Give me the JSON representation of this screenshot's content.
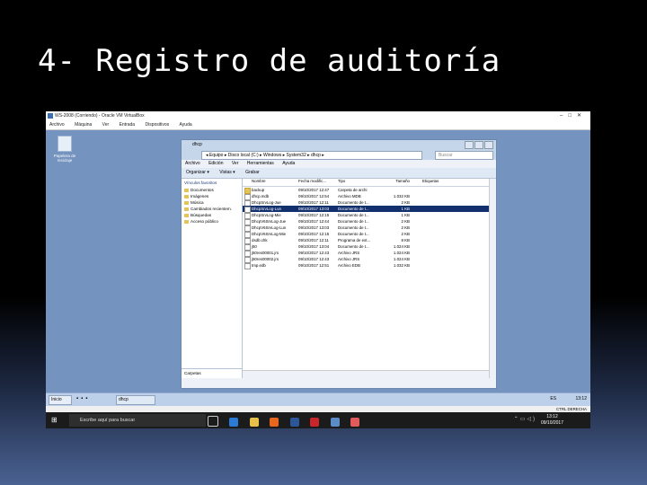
{
  "slide": {
    "title": "4- Registro de auditoría"
  },
  "vbox": {
    "title": "WS-2008 (Corriendo) - Oracle VM VirtualBox",
    "menu": [
      "Archivo",
      "Máquina",
      "Ver",
      "Entrada",
      "Dispositivos",
      "Ayuda"
    ],
    "status_right": "CTRL DERECHA"
  },
  "desktop": {
    "recycle_label": "Papelera de reciclaje"
  },
  "explorer": {
    "title": "dhcp",
    "address": "◂ Equipo ▸ Disco local (C:) ▸ Windows ▸ System32 ▸ dhcp ▸",
    "search_placeholder": "Buscar",
    "menu": [
      "Archivo",
      "Edición",
      "Ver",
      "Herramientas",
      "Ayuda"
    ],
    "toolbar": [
      "Organizar ▾",
      "Vistas ▾",
      "Grabar"
    ],
    "nav_header": "Vínculos favoritos",
    "nav_items": [
      "Documentos",
      "Imágenes",
      "Música",
      "Cambiados recientem.",
      "Búsquedas",
      "Acceso público"
    ],
    "nav_footer": "Carpetas",
    "columns": [
      "Nombre",
      "Fecha modific...",
      "Tipo",
      "Tamaño",
      "Etiquetas"
    ],
    "rows": [
      {
        "name": "backup",
        "date": "09/10/2017 12:47",
        "type": "Carpeta de archi",
        "size": "",
        "folder": true
      },
      {
        "name": "dhcp.mdb",
        "date": "09/10/2017 12:54",
        "type": "Archivo MDB",
        "size": "1.032 KB"
      },
      {
        "name": "DhcpSrvLog-Jue",
        "date": "09/10/2017 12:11",
        "type": "Documento de t...",
        "size": "2 KB"
      },
      {
        "name": "DhcpSrvLog-Lun",
        "date": "09/10/2017 13:03",
        "type": "Documento de t...",
        "size": "1 KB",
        "selected": true
      },
      {
        "name": "DhcpSrvLog-Mie",
        "date": "09/10/2017 12:15",
        "type": "Documento de t...",
        "size": "1 KB"
      },
      {
        "name": "DhcpV6SrvLog-Jue",
        "date": "09/10/2017 12:44",
        "type": "Documento de t...",
        "size": "2 KB"
      },
      {
        "name": "DhcpV6SrvLog-Lun",
        "date": "09/10/2017 13:03",
        "type": "Documento de t...",
        "size": "2 KB"
      },
      {
        "name": "DhcpV6SrvLog-Mie",
        "date": "09/10/2017 12:15",
        "type": "Documento de t...",
        "size": "2 KB"
      },
      {
        "name": "dsdb.chk",
        "date": "09/10/2017 12:11",
        "type": "Programa de ext...",
        "size": "8 KB"
      },
      {
        "name": "j50",
        "date": "09/10/2017 13:04",
        "type": "Documento de t...",
        "size": "1.024 KB"
      },
      {
        "name": "j50res00001.jrs",
        "date": "09/10/2017 12:43",
        "type": "Archivo JRS",
        "size": "1.024 KB"
      },
      {
        "name": "j50res00002.jrs",
        "date": "09/10/2017 12:43",
        "type": "Archivo JRS",
        "size": "1.024 KB"
      },
      {
        "name": "tmp.edb",
        "date": "09/10/2017 12:51",
        "type": "Archivo EDB",
        "size": "1.032 KB"
      }
    ]
  },
  "guest_taskbar": {
    "start": "Inicio",
    "window": "dhcp",
    "lang": "ES",
    "time": "13:12"
  },
  "host_taskbar": {
    "search": "Escribe aquí para buscar",
    "time": "13:12",
    "date": "09/10/2017"
  }
}
